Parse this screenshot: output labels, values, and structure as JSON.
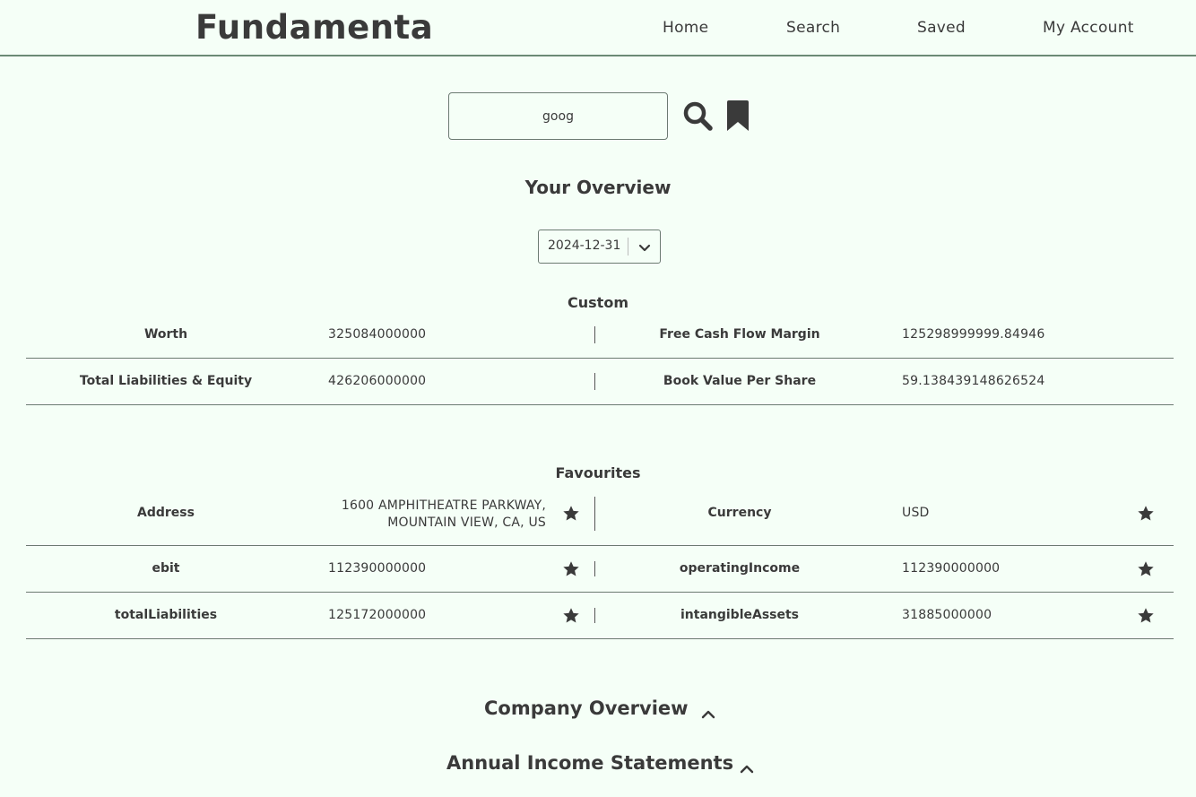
{
  "header": {
    "brand": "Fundamenta",
    "nav": {
      "home": "Home",
      "search": "Search",
      "saved": "Saved",
      "account": "My Account"
    }
  },
  "search": {
    "value": "goog"
  },
  "overview": {
    "title": "Your Overview",
    "date": "2024-12-31"
  },
  "custom": {
    "title": "Custom",
    "rows": [
      {
        "left": {
          "label": "Worth",
          "value": "325084000000"
        },
        "right": {
          "label": "Free Cash Flow Margin",
          "value": "125298999999.84946"
        }
      },
      {
        "left": {
          "label": "Total Liabilities & Equity",
          "value": "426206000000"
        },
        "right": {
          "label": "Book Value Per Share",
          "value": "59.138439148626524"
        }
      }
    ]
  },
  "favourites": {
    "title": "Favourites",
    "rows": [
      {
        "left": {
          "label": "Address",
          "value_line1": "1600 AMPHITHEATRE PARKWAY,",
          "value_line2": "MOUNTAIN VIEW, CA, US"
        },
        "right": {
          "label": "Currency",
          "value": "USD"
        }
      },
      {
        "left": {
          "label": "ebit",
          "value": "112390000000"
        },
        "right": {
          "label": "operatingIncome",
          "value": "112390000000"
        }
      },
      {
        "left": {
          "label": "totalLiabilities",
          "value": "125172000000"
        },
        "right": {
          "label": "intangibleAssets",
          "value": "31885000000"
        }
      }
    ]
  },
  "sections": {
    "company_overview": "Company Overview",
    "annual_income": "Annual Income Statements"
  },
  "icons": {
    "search": "search-icon",
    "bookmark": "bookmark-icon",
    "star": "star-icon",
    "chevron_down": "chevron-down-icon",
    "chevron_up": "chevron-up-icon"
  },
  "colors": {
    "background": "#f5fff7",
    "text": "#3a3a3a",
    "border": "#6c8a76"
  }
}
